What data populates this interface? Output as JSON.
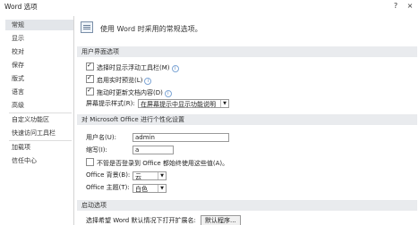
{
  "window": {
    "title": "Word 选项",
    "help_icon": "?",
    "close_icon": "×"
  },
  "sidebar": {
    "items": [
      "常规",
      "显示",
      "校对",
      "保存",
      "版式",
      "语言",
      "高级",
      "自定义功能区",
      "快速访问工具栏",
      "加载项",
      "信任中心"
    ]
  },
  "header": {
    "text": "使用 Word 时采用的常规选项。"
  },
  "ui_section": {
    "title": "用户界面选项",
    "options": [
      {
        "label": "选择时显示浮动工具栏(M)",
        "checked": true
      },
      {
        "label": "启用实时预览(L)",
        "checked": true
      },
      {
        "label": "拖动时更新文档内容(D)",
        "checked": true
      }
    ],
    "screentip_label": "屏幕提示样式(R):",
    "screentip_value": "在屏幕提示中显示功能说明"
  },
  "personal_section": {
    "title": "对 Microsoft Office 进行个性化设置",
    "username_label": "用户名(U):",
    "username_value": "admin",
    "initials_label": "缩写(I):",
    "initials_value": "a",
    "always_use_label": "不管是否登录到 Office 都始终使用这些值(A)。",
    "always_use_checked": false,
    "background_label": "Office 背景(B):",
    "background_value": "云",
    "theme_label": "Office 主题(T):",
    "theme_value": "白色"
  },
  "startup_section": {
    "title": "启动选项",
    "default_label": "选择希望 Word 默认情况下打开扩展名:",
    "default_button": "默认程序..."
  }
}
